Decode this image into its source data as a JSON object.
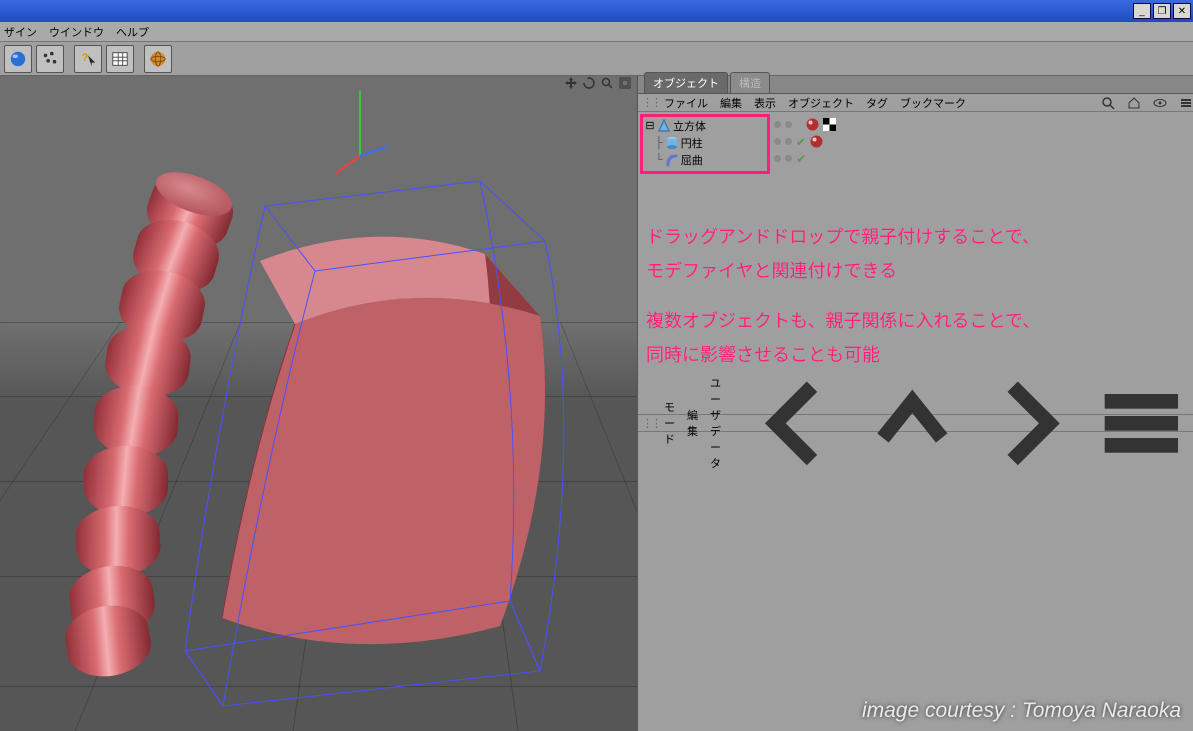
{
  "window_controls": {
    "min": "_",
    "max": "❐",
    "close": "✕"
  },
  "menubar": {
    "items": [
      "ザイン",
      "ウインドウ",
      "ヘルプ"
    ]
  },
  "toolbar": {
    "buttons": [
      "sphere-icon",
      "particles-icon",
      "help-arrow-icon",
      "spreadsheet-icon",
      "globe-icon"
    ]
  },
  "viewport": {
    "nav_icons": [
      "move-icon",
      "rotate-icon",
      "zoom-icon",
      "frame-icon"
    ]
  },
  "tabs": {
    "object": "オブジェクト",
    "structure": "構造"
  },
  "object_manager": {
    "menus": [
      "ファイル",
      "編集",
      "表示",
      "オブジェクト",
      "タグ",
      "ブックマーク"
    ],
    "tree": [
      {
        "name": "立方体",
        "icon": "cone-icon",
        "expanded": true
      },
      {
        "name": "円柱",
        "icon": "cylinder-icon"
      },
      {
        "name": "屈曲",
        "icon": "bend-icon"
      }
    ]
  },
  "attributes": {
    "menus": [
      "モード",
      "編集",
      "ユーザデータ"
    ]
  },
  "annotation": {
    "line1": "ドラッグアンドドロップで親子付けすることで、",
    "line2": "モデファイヤと関連付けできる",
    "line3": "複数オブジェクトも、親子関係に入れることで、",
    "line4": "同時に影響させることも可能"
  },
  "credit": "image courtesy : Tomoya Naraoka"
}
